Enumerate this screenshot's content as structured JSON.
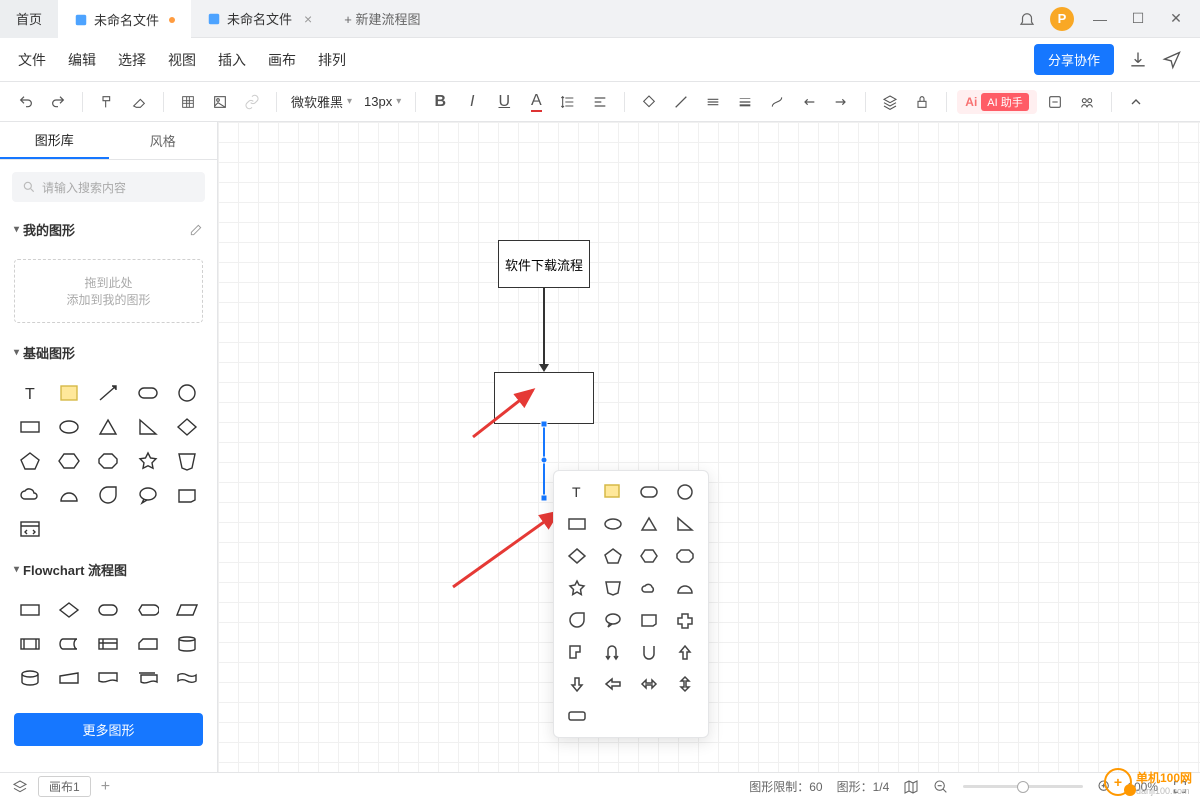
{
  "tabs": {
    "home": "首页",
    "active": "未命名文件",
    "second": "未命名文件",
    "new": "+  新建流程图"
  },
  "avatar": "P",
  "menu": [
    "文件",
    "编辑",
    "选择",
    "视图",
    "插入",
    "画布",
    "排列"
  ],
  "share": "分享协作",
  "toolbar": {
    "font": "微软雅黑",
    "size": "13px",
    "ai_label": "Ai",
    "ai_text": "AI 助手"
  },
  "sidebar": {
    "tabs": [
      "图形库",
      "风格"
    ],
    "search_placeholder": "请输入搜索内容",
    "my_shapes": "我的图形",
    "drop1": "拖到此处",
    "drop2": "添加到我的图形",
    "basic": "基础图形",
    "flowchart": "Flowchart 流程图",
    "more": "更多图形",
    "edit_icon": "edit"
  },
  "canvas": {
    "node1": "软件下载流程"
  },
  "status": {
    "page": "画布1",
    "shape_limit_label": "图形限制：",
    "shape_limit_val": "60",
    "shape_count_label": "图形：",
    "shape_count_val": "1/4",
    "zoom": "100%"
  },
  "watermark": {
    "text": "单机100网",
    "sub": "danji100.com"
  }
}
